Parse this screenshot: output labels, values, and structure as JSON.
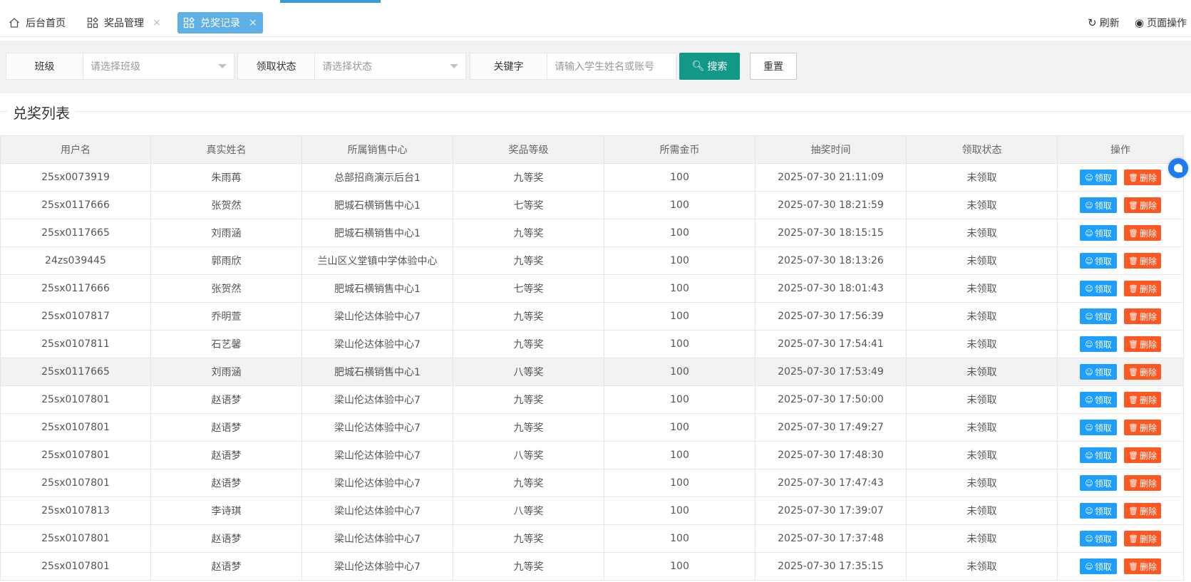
{
  "tabs": {
    "home": "后台首页",
    "prize_mgmt": "奖品管理",
    "records": "兑奖记录",
    "close": "×",
    "refresh": "刷新",
    "page_ops": "页面操作"
  },
  "filters": {
    "class_label": "班级",
    "class_placeholder": "请选择班级",
    "status_label": "领取状态",
    "status_placeholder": "请选择状态",
    "keyword_label": "关键字",
    "keyword_placeholder": "请输入学生姓名或账号",
    "search_label": "搜索",
    "reset_label": "重置"
  },
  "section_title": "兑奖列表",
  "table": {
    "columns": [
      "用户名",
      "真实姓名",
      "所属销售中心",
      "奖品等级",
      "所需金币",
      "抽奖时间",
      "领取状态",
      "操作"
    ],
    "claim_label": "领取",
    "delete_label": "删除",
    "rows": [
      [
        "25sx0073919",
        "朱雨苒",
        "总部招商演示后台1",
        "九等奖",
        "100",
        "2025-07-30 21:11:09",
        "未领取"
      ],
      [
        "25sx0117666",
        "张贺然",
        "肥城石横销售中心1",
        "七等奖",
        "100",
        "2025-07-30 18:21:59",
        "未领取"
      ],
      [
        "25sx0117665",
        "刘雨涵",
        "肥城石横销售中心1",
        "九等奖",
        "100",
        "2025-07-30 18:15:15",
        "未领取"
      ],
      [
        "24zs039445",
        "郭雨欣",
        "兰山区义堂镇中学体验中心",
        "九等奖",
        "100",
        "2025-07-30 18:13:26",
        "未领取"
      ],
      [
        "25sx0117666",
        "张贺然",
        "肥城石横销售中心1",
        "七等奖",
        "100",
        "2025-07-30 18:01:43",
        "未领取"
      ],
      [
        "25sx0107817",
        "乔明萱",
        "梁山伦达体验中心7",
        "九等奖",
        "100",
        "2025-07-30 17:56:39",
        "未领取"
      ],
      [
        "25sx0107811",
        "石艺馨",
        "梁山伦达体验中心7",
        "九等奖",
        "100",
        "2025-07-30 17:54:41",
        "未领取"
      ],
      [
        "25sx0117665",
        "刘雨涵",
        "肥城石横销售中心1",
        "八等奖",
        "100",
        "2025-07-30 17:53:49",
        "未领取"
      ],
      [
        "25sx0107801",
        "赵语梦",
        "梁山伦达体验中心7",
        "九等奖",
        "100",
        "2025-07-30 17:50:00",
        "未领取"
      ],
      [
        "25sx0107801",
        "赵语梦",
        "梁山伦达体验中心7",
        "九等奖",
        "100",
        "2025-07-30 17:49:27",
        "未领取"
      ],
      [
        "25sx0107801",
        "赵语梦",
        "梁山伦达体验中心7",
        "八等奖",
        "100",
        "2025-07-30 17:48:30",
        "未领取"
      ],
      [
        "25sx0107801",
        "赵语梦",
        "梁山伦达体验中心7",
        "九等奖",
        "100",
        "2025-07-30 17:47:43",
        "未领取"
      ],
      [
        "25sx0107813",
        "李诗琪",
        "梁山伦达体验中心7",
        "八等奖",
        "100",
        "2025-07-30 17:39:07",
        "未领取"
      ],
      [
        "25sx0107801",
        "赵语梦",
        "梁山伦达体验中心7",
        "九等奖",
        "100",
        "2025-07-30 17:37:48",
        "未领取"
      ],
      [
        "25sx0107801",
        "赵语梦",
        "梁山伦达体验中心7",
        "九等奖",
        "100",
        "2025-07-30 17:35:15",
        "未领取"
      ]
    ],
    "highlight_row": 7
  },
  "colors": {
    "accent": "#129886",
    "claim": "#1e9fff",
    "delete": "#ff5722",
    "active_tab": "#5fb0e6"
  }
}
